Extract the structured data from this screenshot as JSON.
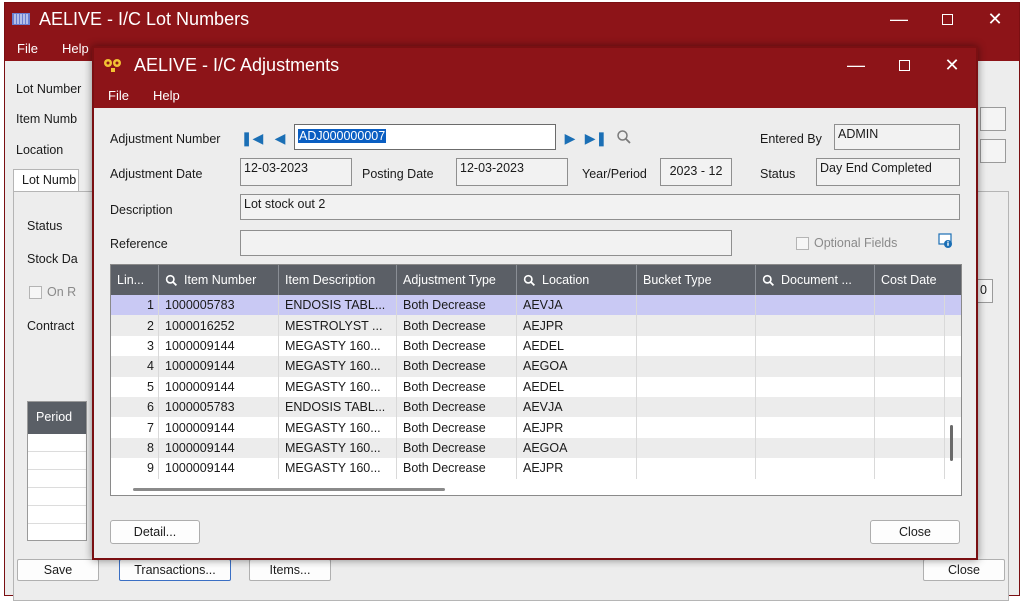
{
  "colors": {
    "titlebar": "#8d1418",
    "grid_header": "#5b5f66",
    "selection": "#0a5ec2",
    "selected_row": "#c9c9f4",
    "nav_arrow": "#1b6fb5"
  },
  "background_window": {
    "icon": "database-grid-icon",
    "title": "AELIVE - I/C Lot Numbers",
    "menu": [
      "File",
      "Help"
    ],
    "labels": {
      "lot_number": "Lot Number",
      "item_number": "Item Numb",
      "location": "Location"
    },
    "tab": "Lot Numb",
    "panel_labels": {
      "status": "Status",
      "stock_date": "Stock Da",
      "on_hold": "On R",
      "contract": "Contract"
    },
    "grid_header": "Period",
    "partial_value": "0",
    "buttons": {
      "save": "Save",
      "transactions": "Transactions...",
      "items": "Items...",
      "close": "Close"
    }
  },
  "dialog": {
    "icon": "adjustment-icon",
    "title": "AELIVE - I/C Adjustments",
    "menu": [
      "File",
      "Help"
    ],
    "labels": {
      "adjustment_number": "Adjustment Number",
      "entered_by": "Entered By",
      "adjustment_date": "Adjustment Date",
      "posting_date": "Posting Date",
      "year_period": "Year/Period",
      "status": "Status",
      "description": "Description",
      "reference": "Reference"
    },
    "values": {
      "adjustment_number": "ADJ000000007",
      "entered_by": "ADMIN",
      "adjustment_date": "12-03-2023",
      "posting_date": "12-03-2023",
      "year_period": "2023 - 12",
      "status": "Day End Completed",
      "description": "Lot stock out 2",
      "reference": ""
    },
    "optional_fields": "Optional Fields",
    "columns": [
      "Lin...",
      "Item Number",
      "Item Description",
      "Adjustment Type",
      "Location",
      "Bucket Type",
      "Document ...",
      "Cost Date"
    ],
    "rows": [
      {
        "line": "1",
        "item": "1000005783",
        "desc": "ENDOSIS TABL...",
        "type": "Both Decrease",
        "loc": "AEVJA"
      },
      {
        "line": "2",
        "item": "1000016252",
        "desc": "MESTROLYST ...",
        "type": "Both Decrease",
        "loc": "AEJPR"
      },
      {
        "line": "3",
        "item": "1000009144",
        "desc": "MEGASTY 160...",
        "type": "Both Decrease",
        "loc": "AEDEL"
      },
      {
        "line": "4",
        "item": "1000009144",
        "desc": "MEGASTY 160...",
        "type": "Both Decrease",
        "loc": "AEGOA"
      },
      {
        "line": "5",
        "item": "1000009144",
        "desc": "MEGASTY 160...",
        "type": "Both Decrease",
        "loc": "AEDEL"
      },
      {
        "line": "6",
        "item": "1000005783",
        "desc": "ENDOSIS TABL...",
        "type": "Both Decrease",
        "loc": "AEVJA"
      },
      {
        "line": "7",
        "item": "1000009144",
        "desc": "MEGASTY 160...",
        "type": "Both Decrease",
        "loc": "AEJPR"
      },
      {
        "line": "8",
        "item": "1000009144",
        "desc": "MEGASTY 160...",
        "type": "Both Decrease",
        "loc": "AEGOA"
      },
      {
        "line": "9",
        "item": "1000009144",
        "desc": "MEGASTY 160...",
        "type": "Both Decrease",
        "loc": "AEJPR"
      }
    ],
    "buttons": {
      "detail": "Detail...",
      "close": "Close"
    }
  }
}
